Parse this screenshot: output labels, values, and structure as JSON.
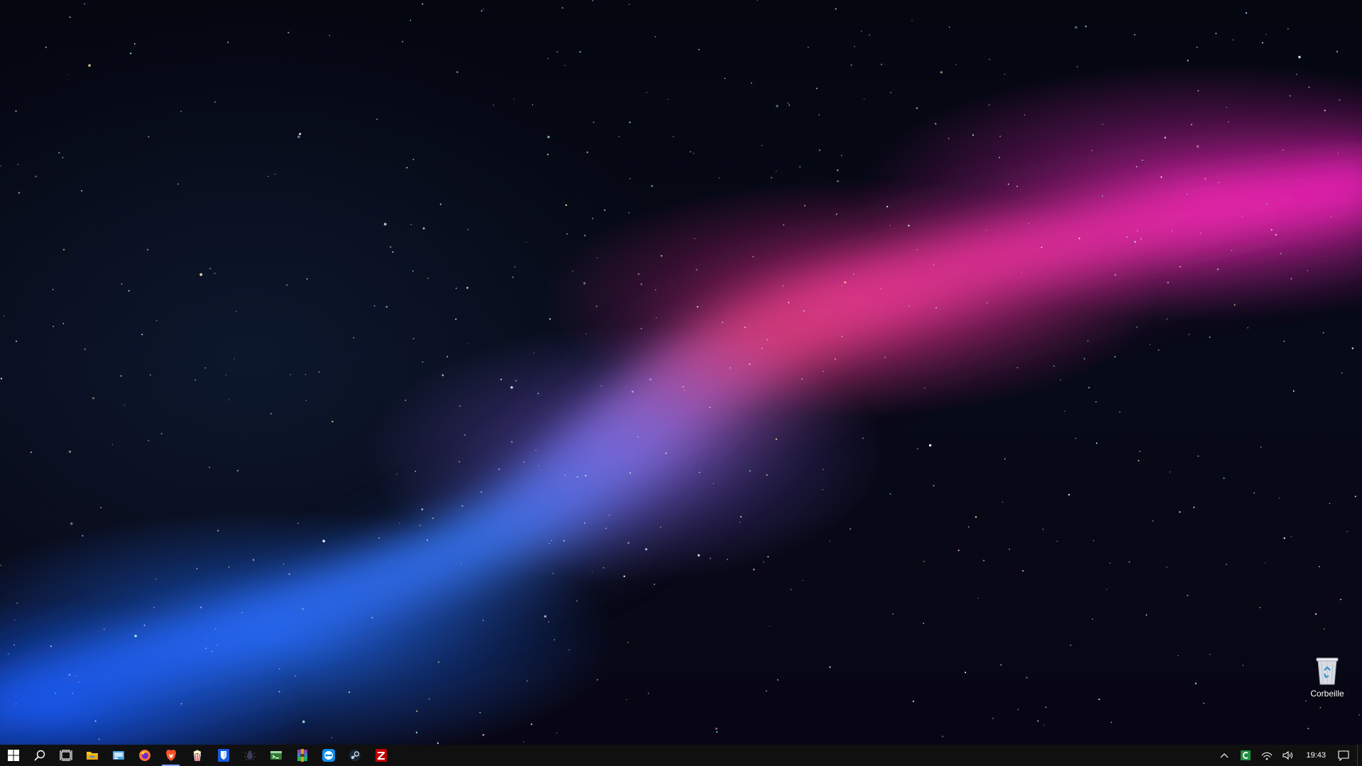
{
  "desktop": {
    "icons": [
      {
        "label": "Corbeille",
        "icon": "recycle-bin-icon"
      }
    ]
  },
  "taskbar": {
    "start_icon": "windows-start-icon",
    "search_icon": "search-icon",
    "task_view_icon": "task-view-icon",
    "pinned_apps": [
      {
        "icon": "file-explorer-icon",
        "color": "#f5c518"
      },
      {
        "icon": "control-panel-icon",
        "color": "#4aa3df"
      },
      {
        "icon": "firefox-icon",
        "color": "#ff7139"
      },
      {
        "icon": "brave-icon",
        "color": "#fb542b"
      },
      {
        "icon": "popcorn-icon",
        "color": "#e84a4a"
      },
      {
        "icon": "bitwarden-icon",
        "color": "#175ddc"
      },
      {
        "icon": "bug-icon",
        "color": "#3a3a5a"
      },
      {
        "icon": "terminal-icon",
        "color": "#4caf50"
      },
      {
        "icon": "winrar-icon",
        "color": "#8e44ad"
      },
      {
        "icon": "teamviewer-icon",
        "color": "#0e8ee9"
      },
      {
        "icon": "steam-icon",
        "color": "#c7d5e0"
      },
      {
        "icon": "filezilla-icon",
        "color": "#bf0000"
      }
    ],
    "tray": {
      "chevron_icon": "chevron-up-icon",
      "app_icon": "ccleaner-icon",
      "network_icon": "wifi-icon",
      "volume_icon": "speaker-icon",
      "time": "19:43",
      "notifications_icon": "action-center-icon"
    },
    "accent": "#7da6ff"
  }
}
